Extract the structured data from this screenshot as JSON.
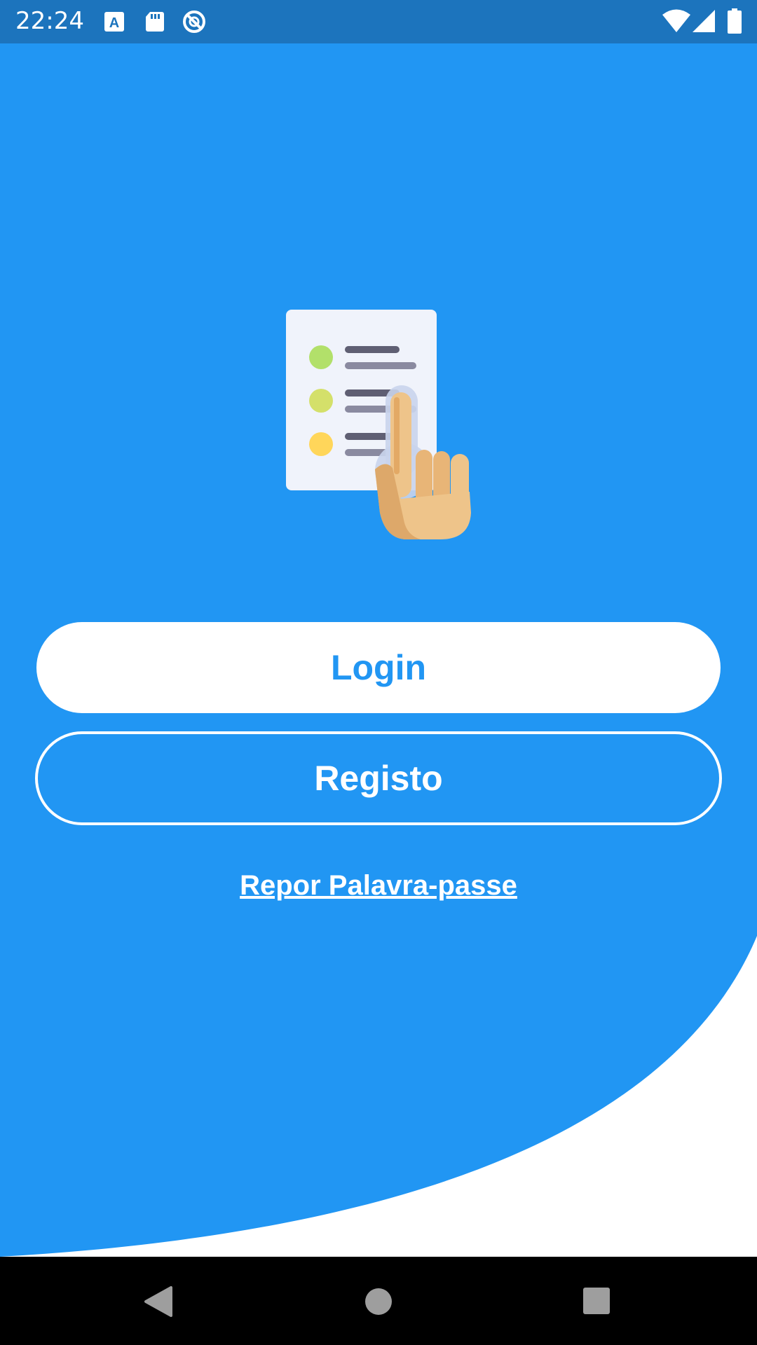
{
  "status_bar": {
    "time": "22:24",
    "left_icons": [
      "text-a-icon",
      "sd-card-icon",
      "data-saver-icon"
    ],
    "right_icons": [
      "wifi-icon",
      "cell-signal-icon",
      "battery-icon"
    ]
  },
  "main": {
    "illustration": "checklist-hand-tap-icon",
    "login_label": "Login",
    "register_label": "Registo",
    "reset_password_label": "Repor Palavra-passe"
  },
  "nav_bar": {
    "icons": [
      "back-icon",
      "home-icon",
      "recents-icon"
    ]
  },
  "colors": {
    "primary": "#2196f3",
    "status_bar": "#1c74bd",
    "white": "#ffffff",
    "nav_bar": "#000000"
  }
}
